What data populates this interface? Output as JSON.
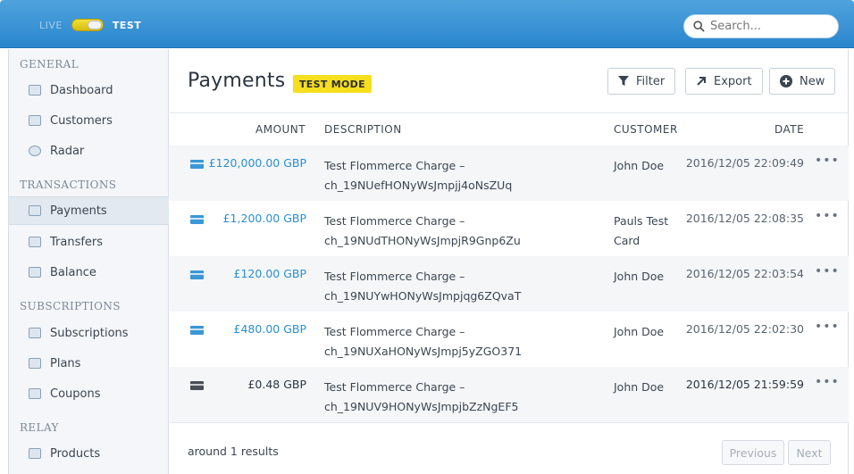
{
  "topbar": {
    "mode_live": "LIVE",
    "mode_test": "TEST",
    "search_placeholder": "Search..."
  },
  "sidebar": {
    "sections": [
      {
        "heading": "GENERAL",
        "items": [
          {
            "label": "Dashboard",
            "icon": "dashboard-icon"
          },
          {
            "label": "Customers",
            "icon": "customers-icon"
          },
          {
            "label": "Radar",
            "icon": "radar-icon"
          }
        ]
      },
      {
        "heading": "TRANSACTIONS",
        "items": [
          {
            "label": "Payments",
            "icon": "payments-icon",
            "active": true
          },
          {
            "label": "Transfers",
            "icon": "transfers-icon"
          },
          {
            "label": "Balance",
            "icon": "balance-icon"
          }
        ]
      },
      {
        "heading": "SUBSCRIPTIONS",
        "items": [
          {
            "label": "Subscriptions",
            "icon": "subscriptions-icon"
          },
          {
            "label": "Plans",
            "icon": "plans-icon"
          },
          {
            "label": "Coupons",
            "icon": "coupons-icon"
          }
        ]
      },
      {
        "heading": "RELAY",
        "items": [
          {
            "label": "Products",
            "icon": "products-icon"
          }
        ]
      }
    ]
  },
  "main": {
    "title": "Payments",
    "badge": "TEST MODE",
    "buttons": {
      "filter": "Filter",
      "export": "Export",
      "new": "New"
    },
    "columns": {
      "amount": "AMOUNT",
      "description": "DESCRIPTION",
      "customer": "CUSTOMER",
      "date": "DATE"
    },
    "rows": [
      {
        "amount": "£120,000.00 GBP",
        "description": "Test Flommerce Charge –",
        "charge_id": "ch_19NUefHONyWsJmpjj4oNsZUq",
        "customer": "John Doe",
        "date": "2016/12/05 22:09:49",
        "more": "•••"
      },
      {
        "amount": "£1,200.00 GBP",
        "description": "Test Flommerce Charge –",
        "charge_id": "ch_19NUdTHONyWsJmpjR9Gnp6Zu",
        "customer": "Pauls Test Card",
        "date": "2016/12/05 22:08:35",
        "more": "•••"
      },
      {
        "amount": "£120.00 GBP",
        "description": "Test Flommerce Charge –",
        "charge_id": "ch_19NUYwHONyWsJmpjqg6ZQvaT",
        "customer": "John Doe",
        "date": "2016/12/05 22:03:54",
        "more": "•••"
      },
      {
        "amount": "£480.00 GBP",
        "description": "Test Flommerce Charge –",
        "charge_id": "ch_19NUXaHONyWsJmpj5yZGO371",
        "customer": "John Doe",
        "date": "2016/12/05 22:02:30",
        "more": "•••"
      },
      {
        "amount": "£0.48 GBP",
        "description": "Test Flommerce Charge –",
        "charge_id": "ch_19NUV9HONyWsJmpjbZzNgEF5",
        "customer": "John Doe",
        "date": "2016/12/05 21:59:59",
        "more": "•••"
      }
    ],
    "results_text": "around 1 results",
    "pagination": {
      "previous": "Previous",
      "next": "Next"
    }
  },
  "colors": {
    "topbar": "#2a86cd",
    "link": "#2b8fd1",
    "badge": "#f5df1e",
    "toggle": "#f3e03a"
  }
}
